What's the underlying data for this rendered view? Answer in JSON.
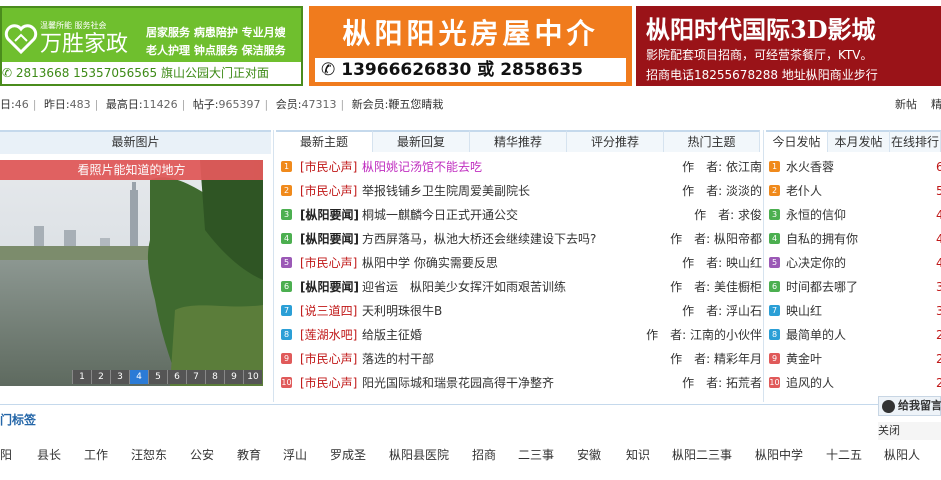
{
  "banners": {
    "wansheng": {
      "slogan": "温馨所能 服务社会",
      "brand": "万胜家政",
      "services_row1": "居家服务  病患陪护  专业月嫂",
      "services_row2": "老人护理  钟点服务  保洁服务",
      "phones": "2813668  15357056565 旗山公园大门正对面"
    },
    "sunshine": {
      "title": "枞阳阳光房屋中介",
      "phone": "13966626830 或 2858635"
    },
    "cinema": {
      "title": "枞阳时代国际3D影城",
      "line2": "影院配套项目招商，可经营茶餐厅，KTV。",
      "line3": "招商电话18255678288   地址枞阳商业步行"
    }
  },
  "stats": {
    "today_label": "日:",
    "today": "46",
    "yesterday_label": "昨日:",
    "yesterday": "483",
    "max_label": "最高日:",
    "max": "11426",
    "posts_label": "帖子:",
    "posts": "965397",
    "members_label": "会员:",
    "members": "47313",
    "new_member_label": "新会员:",
    "new_member": "鞭五您睛栽",
    "new_posts": "新帖",
    "featured": "精"
  },
  "pictures": {
    "header": "最新图片",
    "caption": "看照片能知道的地方",
    "pages": [
      "1",
      "2",
      "3",
      "4",
      "5",
      "6",
      "7",
      "8",
      "9",
      "10"
    ],
    "active_page": 4
  },
  "tabs": [
    "最新主题",
    "最新回复",
    "精华推荐",
    "评分推荐",
    "热门主题"
  ],
  "threads": [
    {
      "n": "1",
      "color": "#f08a1c",
      "forum": "[市民心声]",
      "forum_bold": false,
      "title": "枞阳姚记汤馆不能去吃",
      "title_color": "#c02ec0",
      "author": "作　者: 依江南"
    },
    {
      "n": "2",
      "color": "#f08a1c",
      "forum": "[市民心声]",
      "forum_bold": false,
      "title": "举报钱铺乡卫生院周爱美副院长",
      "title_color": "#333",
      "author": "作　者: 淡淡的"
    },
    {
      "n": "3",
      "color": "#4caf50",
      "forum": "[枞阳要闻]",
      "forum_bold": true,
      "title": "桐城一麒麟今日正式开通公交",
      "title_color": "#333",
      "author": "作　者: 求俊"
    },
    {
      "n": "4",
      "color": "#4caf50",
      "forum": "[枞阳要闻]",
      "forum_bold": true,
      "title": "方西屏落马，枞池大桥还会继续建设下去吗?",
      "title_color": "#333",
      "author": "作　者: 枞阳帝都"
    },
    {
      "n": "5",
      "color": "#9b59b6",
      "forum": "[市民心声]",
      "forum_bold": false,
      "title": "枞阳中学 你确实需要反思",
      "title_color": "#333",
      "author": "作　者: 映山红"
    },
    {
      "n": "6",
      "color": "#4caf50",
      "forum": "[枞阳要闻]",
      "forum_bold": true,
      "title": "迎省运　枞阳美少女挥汗如雨艰苦训练",
      "title_color": "#333",
      "author": "作　者: 美佳橱柜"
    },
    {
      "n": "7",
      "color": "#2b9fd6",
      "forum": "[说三道四]",
      "forum_bold": false,
      "title": "天利明珠很牛B",
      "title_color": "#333",
      "author": "作　者: 浮山石"
    },
    {
      "n": "8",
      "color": "#2b9fd6",
      "forum": "[莲湖水吧]",
      "forum_bold": false,
      "title": "给版主征婚",
      "title_color": "#333",
      "author": "作　者: 江南的小伙伴"
    },
    {
      "n": "9",
      "color": "#e05a5a",
      "forum": "[市民心声]",
      "forum_bold": false,
      "title": "落选的村干部",
      "title_color": "#333",
      "author": "作　者: 精彩年月"
    },
    {
      "n": "10",
      "color": "#e05a5a",
      "forum": "[市民心声]",
      "forum_bold": false,
      "title": "阳光国际城和瑞景花园高得干净整齐",
      "title_color": "#333",
      "author": "作　者: 拓荒者"
    }
  ],
  "right_tabs": [
    "今日发帖",
    "本月发帖",
    "在线排行"
  ],
  "users": [
    {
      "n": "1",
      "color": "#f08a1c",
      "name": "水火香蓉",
      "count": "6"
    },
    {
      "n": "2",
      "color": "#f08a1c",
      "name": "老仆人",
      "count": "5"
    },
    {
      "n": "3",
      "color": "#4caf50",
      "name": "永恒的信仰",
      "count": "4"
    },
    {
      "n": "4",
      "color": "#4caf50",
      "name": "自私的拥有你",
      "count": "4"
    },
    {
      "n": "5",
      "color": "#9b59b6",
      "name": "心决定你的",
      "count": "4"
    },
    {
      "n": "6",
      "color": "#4caf50",
      "name": "时间都去哪了",
      "count": "3"
    },
    {
      "n": "7",
      "color": "#2b9fd6",
      "name": "映山红",
      "count": "3"
    },
    {
      "n": "8",
      "color": "#2b9fd6",
      "name": "最简单的人",
      "count": "2"
    },
    {
      "n": "9",
      "color": "#e05a5a",
      "name": "黄金叶",
      "count": "2"
    },
    {
      "n": "10",
      "color": "#e05a5a",
      "name": "追风的人",
      "count": "2"
    }
  ],
  "tags_header": "门标签",
  "tags": [
    "阳",
    "县长",
    "工作",
    "汪恕东",
    "公安",
    "教育",
    "浮山",
    "罗成圣",
    "枞阳县医院",
    "招商",
    "二三事",
    "安徽",
    "知识",
    "枞阳二三事",
    "枞阳中学",
    "十二五",
    "枞阳人"
  ],
  "float": {
    "leave_msg": "给我留言",
    "close": "关闭"
  }
}
